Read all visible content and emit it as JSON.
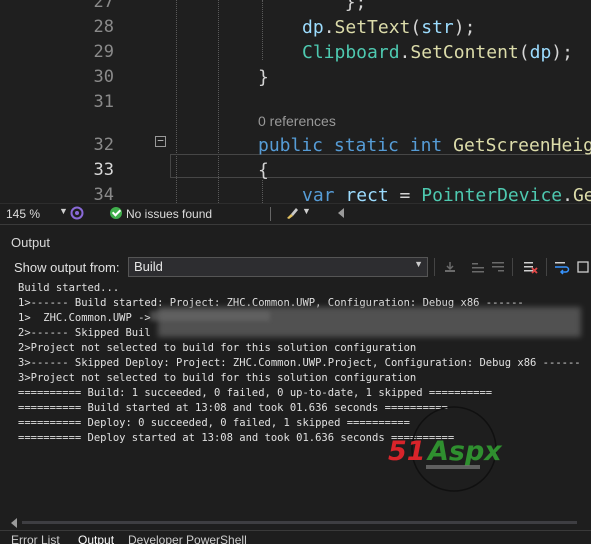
{
  "editor": {
    "lines": [
      {
        "num": "27",
        "tokens": [
          {
            "t": "        };",
            "c": "pl"
          }
        ]
      },
      {
        "num": "28",
        "tokens": [
          {
            "t": "dp",
            "c": "vr"
          },
          {
            "t": ".",
            "c": "pl"
          },
          {
            "t": "SetText",
            "c": "fn"
          },
          {
            "t": "(",
            "c": "pl"
          },
          {
            "t": "str",
            "c": "vr"
          },
          {
            "t": ");",
            "c": "pl"
          }
        ]
      },
      {
        "num": "29",
        "tokens": [
          {
            "t": "Clipboard",
            "c": "tp"
          },
          {
            "t": ".",
            "c": "pl"
          },
          {
            "t": "SetContent",
            "c": "fn"
          },
          {
            "t": "(",
            "c": "pl"
          },
          {
            "t": "dp",
            "c": "vr"
          },
          {
            "t": ");",
            "c": "pl"
          }
        ]
      },
      {
        "num": "30",
        "tokens": [
          {
            "t": "}",
            "c": "pl"
          }
        ]
      },
      {
        "num": "31",
        "tokens": []
      },
      {
        "num": "32",
        "tokens": [
          {
            "t": "public",
            "c": "kw"
          },
          {
            "t": " ",
            "c": "pl"
          },
          {
            "t": "static",
            "c": "kw"
          },
          {
            "t": " ",
            "c": "pl"
          },
          {
            "t": "int",
            "c": "kw"
          },
          {
            "t": " ",
            "c": "pl"
          },
          {
            "t": "GetScreenHeig",
            "c": "fn"
          }
        ]
      },
      {
        "num": "33",
        "tokens": [
          {
            "t": "{",
            "c": "pl"
          }
        ]
      },
      {
        "num": "34",
        "tokens": [
          {
            "t": "var",
            "c": "kw"
          },
          {
            "t": " ",
            "c": "pl"
          },
          {
            "t": "rect",
            "c": "vr"
          },
          {
            "t": " = ",
            "c": "pl"
          },
          {
            "t": "PointerDevice",
            "c": "tp"
          },
          {
            "t": ".",
            "c": "pl"
          },
          {
            "t": "Ge",
            "c": "fn"
          }
        ]
      }
    ],
    "codelens": "0 references",
    "active_line": "33"
  },
  "status": {
    "zoom": "145 %",
    "issues": "No issues found"
  },
  "output": {
    "title": "Output",
    "show_from_label": "Show output from:",
    "source": "Build",
    "lines": [
      "Build started...",
      "1>------ Build started: Project: ZHC.Common.UWP, Configuration: Debug x86 ------",
      "1>  ZHC.Common.UWP ->",
      "2>------ Skipped Buil",
      "2>Project not selected to build for this solution configuration",
      "3>------ Skipped Deploy: Project: ZHC.Common.UWP.Project, Configuration: Debug x86 ------",
      "3>Project not selected to build for this solution configuration",
      "========== Build: 1 succeeded, 0 failed, 0 up-to-date, 1 skipped ==========",
      "========== Build started at 13:08 and took 01.636 seconds ==========",
      "========== Deploy: 0 succeeded, 0 failed, 1 skipped ==========",
      "========== Deploy started at 13:08 and took 01.636 seconds =========="
    ]
  },
  "watermark": {
    "brand": "51Aspx"
  },
  "tabs": [
    "Error List",
    "Output",
    "Developer PowerShell"
  ],
  "colors": {
    "keyword": "#569cd6",
    "type": "#4ec9b0",
    "method": "#dcdcaa",
    "variable": "#9cdcfe",
    "ok": "#3fae4b",
    "accent": "#3794ff"
  }
}
